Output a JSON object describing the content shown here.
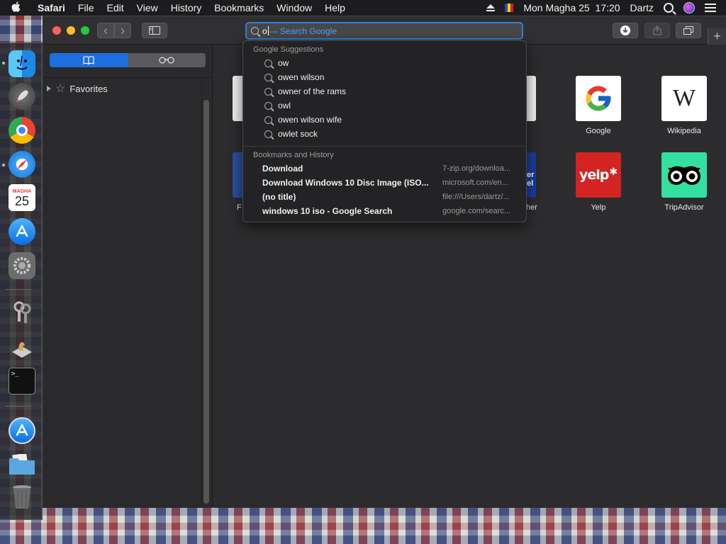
{
  "menubar": {
    "apple": "",
    "app": "Safari",
    "items": [
      "File",
      "Edit",
      "View",
      "History",
      "Bookmarks",
      "Window",
      "Help"
    ],
    "datetime": "Mon Magha 25  17:20",
    "user": "Dartz",
    "icons": [
      "eject-icon",
      "flag-icon",
      "search-icon",
      "siri-icon",
      "control-center-icon"
    ]
  },
  "dock": {
    "calendar_month": "MAGHA",
    "calendar_day": "25",
    "terminal_prompt": ">_"
  },
  "toolbar": {
    "back": "‹",
    "forward": "›",
    "search_query": "o",
    "search_ghost": "— Search Google"
  },
  "sidebar": {
    "favorites_label": "Favorites"
  },
  "favorites": [
    {
      "label": "Google",
      "glyph": "G"
    },
    {
      "label": "Wikipedia",
      "glyph": "W"
    },
    {
      "label": "Yelp",
      "glyph": "yelp"
    },
    {
      "label": "TripAdvisor",
      "glyph": "oo"
    }
  ],
  "partial_labels": {
    "left": "F",
    "right": "her",
    "right_tile": "er el"
  },
  "dropdown": {
    "suggestions_header": "Google Suggestions",
    "suggestions": [
      "ow",
      "owen wilson",
      "owner of the rams",
      "owl",
      "owen wilson wife",
      "owlet sock"
    ],
    "history_header": "Bookmarks and History",
    "history": [
      {
        "title": "Download",
        "url": "7-zip.org/downloa..."
      },
      {
        "title": "Download Windows 10 Disc Image (ISO...",
        "url": "microsoft.com/en..."
      },
      {
        "title": "(no title)",
        "url": "file:///Users/dartz/..."
      },
      {
        "title": "windows 10 iso - Google Search",
        "url": "google.com/searc..."
      }
    ]
  },
  "colors": {
    "accent": "#2f7fd6",
    "window_bg": "#2b2b2d",
    "google_red": "#ea4335",
    "yelp_red": "#d32323",
    "tripadvisor_green": "#34e0a1"
  }
}
